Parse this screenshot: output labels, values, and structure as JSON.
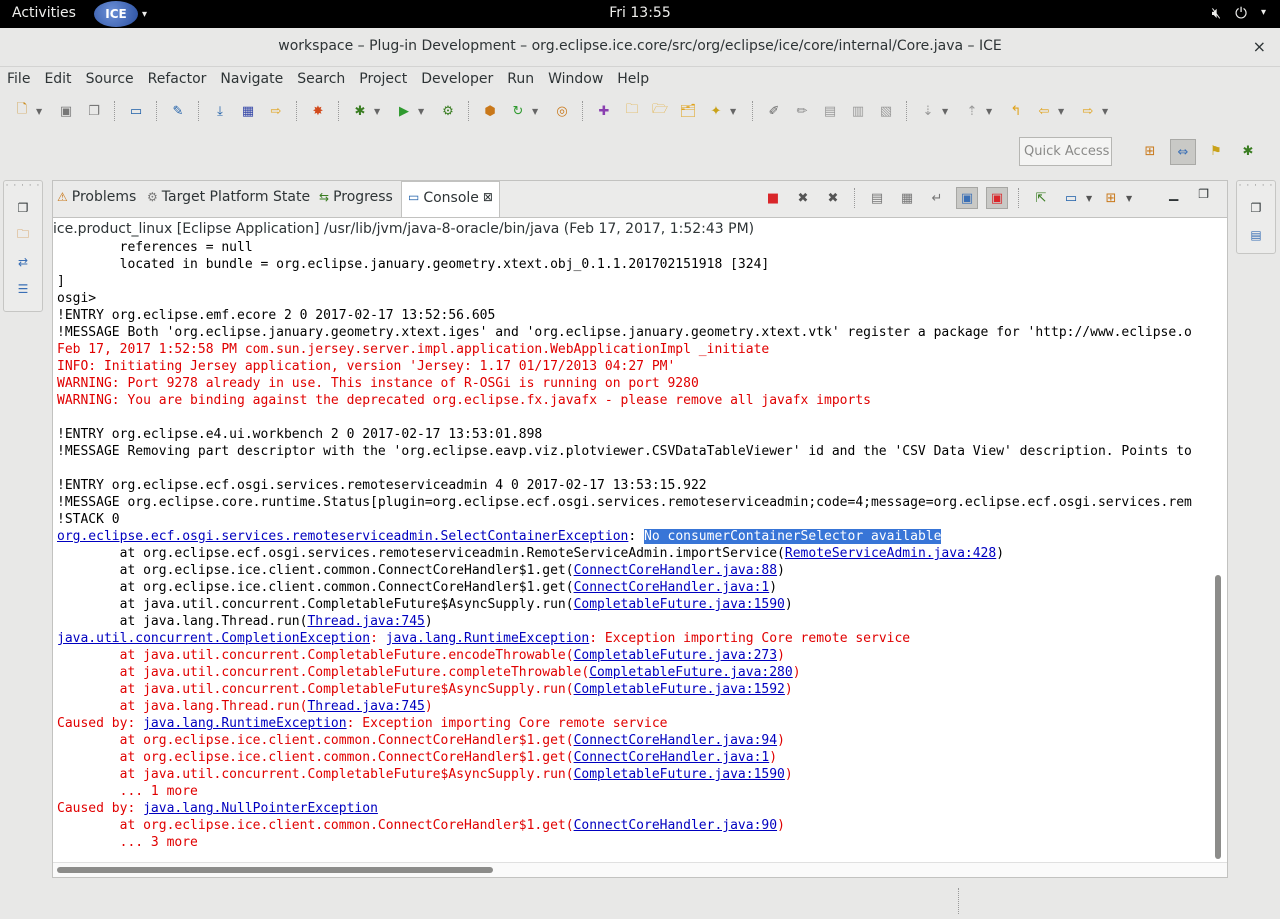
{
  "topbar": {
    "activities": "Activities",
    "app_name": "ICE",
    "clock": "Fri 13:55"
  },
  "window": {
    "title": "workspace – Plug-in Development – org.eclipse.ice.core/src/org/eclipse/ice/core/internal/Core.java – ICE",
    "close": "×"
  },
  "menu": [
    "File",
    "Edit",
    "Source",
    "Refactor",
    "Navigate",
    "Search",
    "Project",
    "Developer",
    "Run",
    "Window",
    "Help"
  ],
  "quick_access": {
    "placeholder": "Quick Access"
  },
  "tabs": [
    {
      "label": "Problems",
      "icon": "problems-icon"
    },
    {
      "label": "Target Platform State",
      "icon": "target-platform-icon"
    },
    {
      "label": "Progress",
      "icon": "progress-icon"
    },
    {
      "label": "Console",
      "icon": "console-icon",
      "active": true,
      "close": "⊠"
    }
  ],
  "console": {
    "header": "ice.product_linux [Eclipse Application] /usr/lib/jvm/java-8-oracle/bin/java (Feb 17, 2017, 1:52:43 PM)",
    "lines": [
      [
        {
          "t": "        references = null",
          "c": "blk"
        }
      ],
      [
        {
          "t": "        located in bundle = org.eclipse.january.geometry.xtext.obj_0.1.1.201702151918 [324]",
          "c": "blk"
        }
      ],
      [
        {
          "t": "]",
          "c": "blk"
        }
      ],
      [
        {
          "t": "osgi>",
          "c": "blk"
        }
      ],
      [
        {
          "t": "!ENTRY org.eclipse.emf.ecore 2 0 2017-02-17 13:52:56.605",
          "c": "blk"
        }
      ],
      [
        {
          "t": "!MESSAGE Both 'org.eclipse.january.geometry.xtext.iges' and 'org.eclipse.january.geometry.xtext.vtk' register a package for 'http://www.eclipse.o",
          "c": "blk"
        }
      ],
      [
        {
          "t": "Feb 17, 2017 1:52:58 PM com.sun.jersey.server.impl.application.WebApplicationImpl _initiate",
          "c": "red"
        }
      ],
      [
        {
          "t": "INFO: Initiating Jersey application, version 'Jersey: 1.17 01/17/2013 04:27 PM'",
          "c": "red"
        }
      ],
      [
        {
          "t": "WARNING: Port 9278 already in use. This instance of R-OSGi is running on port 9280",
          "c": "red"
        }
      ],
      [
        {
          "t": "WARNING: You are binding against the deprecated org.eclipse.fx.javafx - please remove all javafx imports",
          "c": "red"
        }
      ],
      [
        {
          "t": "",
          "c": "blk"
        }
      ],
      [
        {
          "t": "!ENTRY org.eclipse.e4.ui.workbench 2 0 2017-02-17 13:53:01.898",
          "c": "blk"
        }
      ],
      [
        {
          "t": "!MESSAGE Removing part descriptor with the 'org.eclipse.eavp.viz.plotviewer.CSVDataTableViewer' id and the 'CSV Data View' description. Points to",
          "c": "blk"
        }
      ],
      [
        {
          "t": "",
          "c": "blk"
        }
      ],
      [
        {
          "t": "!ENTRY org.eclipse.ecf.osgi.services.remoteserviceadmin 4 0 2017-02-17 13:53:15.922",
          "c": "blk"
        }
      ],
      [
        {
          "t": "!MESSAGE org.eclipse.core.runtime.Status[plugin=org.eclipse.ecf.osgi.services.remoteserviceadmin;code=4;message=org.eclipse.ecf.osgi.services.rem",
          "c": "blk"
        }
      ],
      [
        {
          "t": "!STACK 0",
          "c": "blk"
        }
      ],
      [
        {
          "t": "org.eclipse.ecf.osgi.services.remoteserviceadmin.SelectContainerException",
          "c": "lnk"
        },
        {
          "t": ": ",
          "c": "blk"
        },
        {
          "t": "No consumerContainerSelector available",
          "c": "hl"
        }
      ],
      [
        {
          "t": "        at org.eclipse.ecf.osgi.services.remoteserviceadmin.RemoteServiceAdmin.importService(",
          "c": "blk"
        },
        {
          "t": "RemoteServiceAdmin.java:428",
          "c": "lnk"
        },
        {
          "t": ")",
          "c": "blk"
        }
      ],
      [
        {
          "t": "        at org.eclipse.ice.client.common.ConnectCoreHandler$1.get(",
          "c": "blk"
        },
        {
          "t": "ConnectCoreHandler.java:88",
          "c": "lnk"
        },
        {
          "t": ")",
          "c": "blk"
        }
      ],
      [
        {
          "t": "        at org.eclipse.ice.client.common.ConnectCoreHandler$1.get(",
          "c": "blk"
        },
        {
          "t": "ConnectCoreHandler.java:1",
          "c": "lnk"
        },
        {
          "t": ")",
          "c": "blk"
        }
      ],
      [
        {
          "t": "        at java.util.concurrent.CompletableFuture$AsyncSupply.run(",
          "c": "blk"
        },
        {
          "t": "CompletableFuture.java:1590",
          "c": "lnk"
        },
        {
          "t": ")",
          "c": "blk"
        }
      ],
      [
        {
          "t": "        at java.lang.Thread.run(",
          "c": "blk"
        },
        {
          "t": "Thread.java:745",
          "c": "lnk"
        },
        {
          "t": ")",
          "c": "blk"
        }
      ],
      [
        {
          "t": "java.util.concurrent.CompletionException",
          "c": "lnk"
        },
        {
          "t": ": ",
          "c": "red"
        },
        {
          "t": "java.lang.RuntimeException",
          "c": "lnk"
        },
        {
          "t": ": Exception importing Core remote service",
          "c": "red"
        }
      ],
      [
        {
          "t": "        at java.util.concurrent.CompletableFuture.encodeThrowable(",
          "c": "red"
        },
        {
          "t": "CompletableFuture.java:273",
          "c": "lnk"
        },
        {
          "t": ")",
          "c": "red"
        }
      ],
      [
        {
          "t": "        at java.util.concurrent.CompletableFuture.completeThrowable(",
          "c": "red"
        },
        {
          "t": "CompletableFuture.java:280",
          "c": "lnk"
        },
        {
          "t": ")",
          "c": "red"
        }
      ],
      [
        {
          "t": "        at java.util.concurrent.CompletableFuture$AsyncSupply.run(",
          "c": "red"
        },
        {
          "t": "CompletableFuture.java:1592",
          "c": "lnk"
        },
        {
          "t": ")",
          "c": "red"
        }
      ],
      [
        {
          "t": "        at java.lang.Thread.run(",
          "c": "red"
        },
        {
          "t": "Thread.java:745",
          "c": "lnk"
        },
        {
          "t": ")",
          "c": "red"
        }
      ],
      [
        {
          "t": "Caused by: ",
          "c": "red"
        },
        {
          "t": "java.lang.RuntimeException",
          "c": "lnk"
        },
        {
          "t": ": Exception importing Core remote service",
          "c": "red"
        }
      ],
      [
        {
          "t": "        at org.eclipse.ice.client.common.ConnectCoreHandler$1.get(",
          "c": "red"
        },
        {
          "t": "ConnectCoreHandler.java:94",
          "c": "lnk"
        },
        {
          "t": ")",
          "c": "red"
        }
      ],
      [
        {
          "t": "        at org.eclipse.ice.client.common.ConnectCoreHandler$1.get(",
          "c": "red"
        },
        {
          "t": "ConnectCoreHandler.java:1",
          "c": "lnk"
        },
        {
          "t": ")",
          "c": "red"
        }
      ],
      [
        {
          "t": "        at java.util.concurrent.CompletableFuture$AsyncSupply.run(",
          "c": "red"
        },
        {
          "t": "CompletableFuture.java:1590",
          "c": "lnk"
        },
        {
          "t": ")",
          "c": "red"
        }
      ],
      [
        {
          "t": "        ... 1 more",
          "c": "red"
        }
      ],
      [
        {
          "t": "Caused by: ",
          "c": "red"
        },
        {
          "t": "java.lang.NullPointerException",
          "c": "lnk"
        }
      ],
      [
        {
          "t": "        at org.eclipse.ice.client.common.ConnectCoreHandler$1.get(",
          "c": "red"
        },
        {
          "t": "ConnectCoreHandler.java:90",
          "c": "lnk"
        },
        {
          "t": ")",
          "c": "red"
        }
      ],
      [
        {
          "t": "        ... 3 more",
          "c": "red"
        }
      ]
    ]
  },
  "colors": {
    "error_text": "#e00000",
    "link": "#0000c0",
    "selection": "#3875d7",
    "terminate_red": "#d9262a"
  }
}
